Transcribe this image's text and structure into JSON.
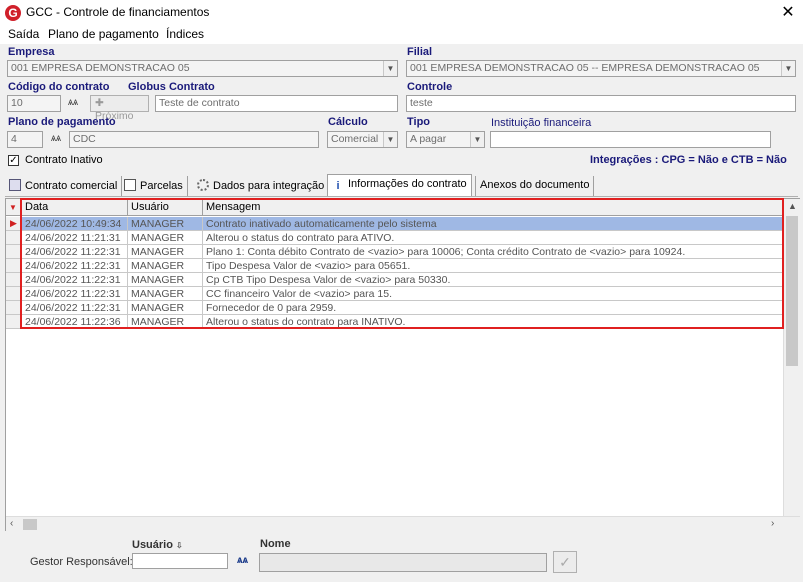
{
  "window": {
    "title": "GCC - Controle de financiamentos",
    "close_glyph": "✕"
  },
  "menu": [
    "Saída",
    "Plano de pagamento",
    "Índices"
  ],
  "empresa": {
    "label": "Empresa",
    "value": "001 EMPRESA DEMONSTRACAO 05"
  },
  "filial": {
    "label": "Filial",
    "value": "001 EMPRESA DEMONSTRACAO 05 -- EMPRESA DEMONSTRACAO 05"
  },
  "codigo": {
    "label": "Código do contrato",
    "value": "10",
    "next_label": "Próximo"
  },
  "globus": {
    "label": "Globus Contrato",
    "value": "Teste de contrato"
  },
  "controle": {
    "label": "Controle",
    "value": "teste"
  },
  "plano": {
    "label": "Plano de pagamento",
    "code": "4",
    "name": "CDC"
  },
  "calculo": {
    "label": "Cálculo",
    "value": "Comercial"
  },
  "tipo": {
    "label": "Tipo",
    "value": "A pagar"
  },
  "instituicao": {
    "label": "Instituição financeira",
    "value": ""
  },
  "contrato_inativo": {
    "label": "Contrato Inativo",
    "checked": true
  },
  "integracoes": "Integrações : CPG = Não e CTB = Não",
  "tabs": [
    "Contrato comercial",
    "Parcelas",
    "Dados para integração",
    "Informações do contrato",
    "Anexos do documento"
  ],
  "active_tab": "Informações do contrato",
  "grid": {
    "headers": [
      "Data",
      "Usuário",
      "Mensagem"
    ],
    "rows": [
      {
        "data": "24/06/2022 10:49:34",
        "usuario": "MANAGER",
        "mensagem": "Contrato inativado automaticamente pelo sistema"
      },
      {
        "data": "24/06/2022 11:21:31",
        "usuario": "MANAGER",
        "mensagem": "Alterou o status do contrato para ATIVO."
      },
      {
        "data": "24/06/2022 11:22:31",
        "usuario": "MANAGER",
        "mensagem": "Plano 1: Conta débito Contrato de <vazio> para 10006; Conta crédito Contrato de <vazio> para 10924."
      },
      {
        "data": "24/06/2022 11:22:31",
        "usuario": "MANAGER",
        "mensagem": "Tipo Despesa Valor de <vazio> para 05651."
      },
      {
        "data": "24/06/2022 11:22:31",
        "usuario": "MANAGER",
        "mensagem": "Cp CTB Tipo Despesa Valor de <vazio> para 50330."
      },
      {
        "data": "24/06/2022 11:22:31",
        "usuario": "MANAGER",
        "mensagem": "CC financeiro Valor de <vazio> para 15."
      },
      {
        "data": "24/06/2022 11:22:31",
        "usuario": "MANAGER",
        "mensagem": "Fornecedor de 0 para 2959."
      },
      {
        "data": "24/06/2022 11:22:36",
        "usuario": "MANAGER",
        "mensagem": "Alterou o status do contrato para INATIVO."
      }
    ]
  },
  "bottom": {
    "usuario_label": "Usuário",
    "nome_label": "Nome",
    "gestor_label": "Gestor Responsável:",
    "usuario_value": "",
    "nome_value": ""
  },
  "colors": {
    "accent_red": "#e02020",
    "label_blue": "#1a1a7a",
    "selected_row": "#9fb8e4"
  }
}
